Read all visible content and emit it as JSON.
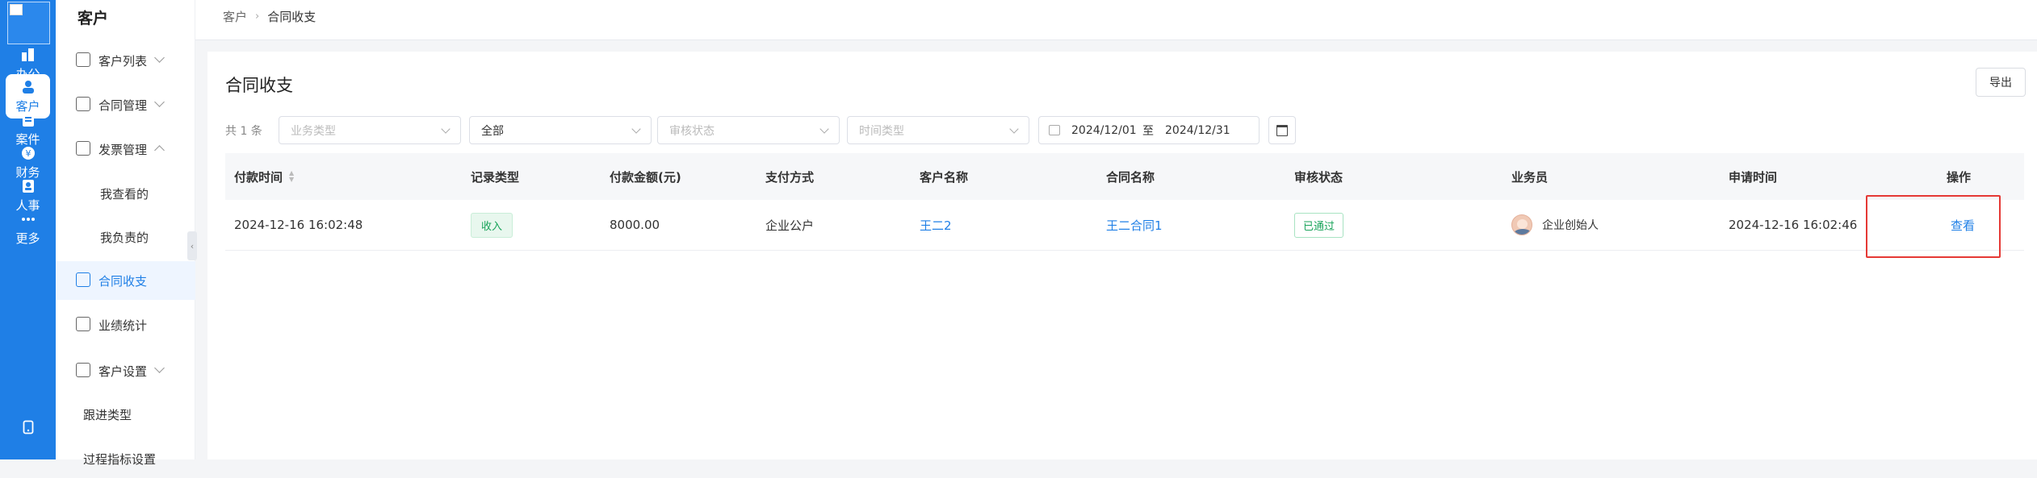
{
  "rail": {
    "items": [
      {
        "label": "办公",
        "icon": "office-icon"
      },
      {
        "label": "客户",
        "icon": "customer-icon",
        "active": true
      },
      {
        "label": "案件",
        "icon": "case-icon"
      },
      {
        "label": "财务",
        "icon": "finance-icon"
      },
      {
        "label": "人事",
        "icon": "hr-icon"
      },
      {
        "label": "更多",
        "icon": "more-icon"
      }
    ]
  },
  "sidebar": {
    "title": "客户",
    "items": [
      {
        "label": "客户列表",
        "expanded": false
      },
      {
        "label": "合同管理",
        "expanded": false
      },
      {
        "label": "发票管理",
        "expanded": true
      },
      {
        "label": "我查看的"
      },
      {
        "label": "我负责的"
      },
      {
        "label": "合同收支",
        "active": true
      },
      {
        "label": "业绩统计"
      },
      {
        "label": "客户设置",
        "expanded": false
      },
      {
        "label": "跟进类型"
      },
      {
        "label": "过程指标设置"
      }
    ]
  },
  "breadcrumb": {
    "root": "客户",
    "current": "合同收支"
  },
  "page": {
    "title": "合同收支",
    "export_label": "导出"
  },
  "filters": {
    "count_text": "共 1 条",
    "business_type_placeholder": "业务类型",
    "all_value": "全部",
    "audit_status_placeholder": "审核状态",
    "time_type_placeholder": "时间类型",
    "date_start": "2024/12/01",
    "date_to": "至",
    "date_end": "2024/12/31"
  },
  "table": {
    "headers": [
      "付款时间",
      "记录类型",
      "付款金额(元)",
      "支付方式",
      "客户名称",
      "合同名称",
      "审核状态",
      "业务员",
      "申请时间",
      "操作"
    ],
    "rows": [
      {
        "pay_time": "2024-12-16 16:02:48",
        "record_type": "收入",
        "amount": "8000.00",
        "pay_method": "企业公户",
        "customer": "王二2",
        "contract": "王二合同1",
        "audit": "已通过",
        "salesman": "企业创始人",
        "apply_time": "2024-12-16 16:02:46",
        "action": "查看"
      }
    ]
  },
  "colors": {
    "accent": "#1f7fe6",
    "success": "#19a35a",
    "highlight": "#e53935"
  }
}
